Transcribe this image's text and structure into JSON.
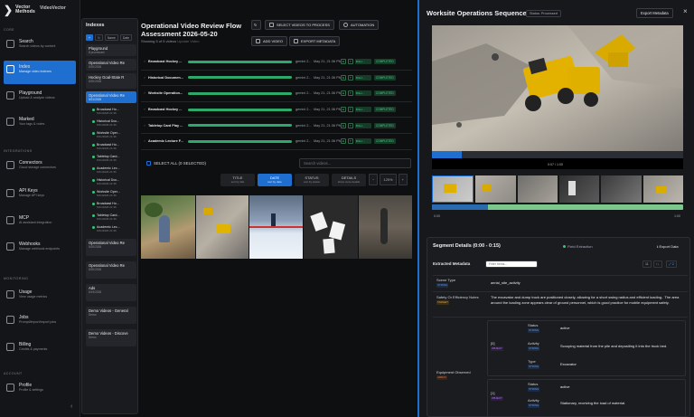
{
  "app": {
    "logo_text": "Vector Methods",
    "product": "VideoVector"
  },
  "nav": {
    "sections": {
      "core": "CORE",
      "integrations": "INTEGRATIONS",
      "monitoring": "MONITORING",
      "account": "ACCOUNT"
    },
    "items": [
      {
        "label": "Search",
        "sub": "Search videos by content"
      },
      {
        "label": "Index",
        "sub": "Manage video indexes"
      },
      {
        "label": "Playground",
        "sub": "Upload & analyze videos"
      },
      {
        "label": "Marked",
        "sub": "Your tags & notes"
      },
      {
        "label": "Connectors",
        "sub": "Cloud storage connectors"
      },
      {
        "label": "API Keys",
        "sub": "Manage API keys"
      },
      {
        "label": "MCP",
        "sub": "AI assistant integration"
      },
      {
        "label": "Webhooks",
        "sub": "Manage webhook endpoints"
      },
      {
        "label": "Usage",
        "sub": "View usage metrics"
      },
      {
        "label": "Jobs",
        "sub": "Prompt/import/export jobs"
      },
      {
        "label": "Billing",
        "sub": "Credits & payments"
      },
      {
        "label": "Profile",
        "sub": "Profile & settings"
      }
    ],
    "active": "Index",
    "collapse_icon": "chevron-left-icon"
  },
  "indexes": {
    "title": "Indexes",
    "tools": [
      "+",
      "↻",
      "Name",
      "Date"
    ],
    "items": [
      {
        "title": "Playground",
        "date": "8 processed"
      },
      {
        "title": "Operational Video Re",
        "date": "5/20/2026"
      },
      {
        "title": "Hockey Goal-State R",
        "date": "5/20/2026"
      },
      {
        "title": "Operational Video Re",
        "date": "5/21/2026"
      }
    ],
    "videos": [
      {
        "title": "Broadcast Ho...",
        "date": "5/21/2026 21:36"
      },
      {
        "title": "Historical Doc...",
        "date": "5/21/2026 21:36"
      },
      {
        "title": "Worksite Oper...",
        "date": "5/21/2026 21:36"
      },
      {
        "title": "Broadcast Ho...",
        "date": "5/21/2026 21:36"
      },
      {
        "title": "Tabletop Card...",
        "date": "5/21/2026 21:36"
      },
      {
        "title": "Academic Lec...",
        "date": "5/21/2026 21:36"
      },
      {
        "title": "Historical Doc...",
        "date": "5/21/2026 21:36"
      },
      {
        "title": "Worksite Oper...",
        "date": "5/21/2026 21:36"
      },
      {
        "title": "Broadcast Ho...",
        "date": "5/21/2026 21:36"
      },
      {
        "title": "Tabletop Card...",
        "date": "5/21/2026 21:36"
      },
      {
        "title": "Academic Lec...",
        "date": "5/21/2026 21:36"
      }
    ],
    "more": [
      {
        "title": "Operational Video Re",
        "date": "5/20/2026"
      },
      {
        "title": "Operational Video Re",
        "date": "5/20/2026"
      },
      {
        "title": "Ads",
        "date": "5/19/2026"
      },
      {
        "title": "Demo Videos - General",
        "date": "Demo"
      },
      {
        "title": "Demo Videos - Discove",
        "date": "Demo"
      }
    ]
  },
  "main": {
    "title": "Operational Video Review Flow Assessment 2026-05-20",
    "count": "Showing 5 of 5 videos",
    "count_link": "Update Video",
    "buttons": {
      "refresh": "↻",
      "select": "SELECT VIDEOS TO PROCESS",
      "automation": "AUTOMATION",
      "add": "ADD VIDEO",
      "export": "EXPORT METADATA"
    },
    "rows": [
      {
        "name": "Broadcast Hockey ...",
        "model": "gemini 2...",
        "date": "May 21, 21:36 PM",
        "b1": "E",
        "b2": "T",
        "b3": "BILLI...",
        "status": "COMPLETED"
      },
      {
        "name": "Historical Documen...",
        "model": "gemini 2...",
        "date": "May 21, 21:36 PM",
        "b1": "E",
        "b2": "T",
        "b3": "BILLI...",
        "status": "COMPLETED"
      },
      {
        "name": "Worksite Operation...",
        "model": "gemini 2...",
        "date": "May 21, 21:36 PM",
        "b1": "E",
        "b2": "T",
        "b3": "BILLI...",
        "status": "COMPLETED"
      },
      {
        "name": "Broadcast Hockey ...",
        "model": "gemini 2...",
        "date": "May 21, 21:36 PM",
        "b1": "E",
        "b2": "T",
        "b3": "BILLI...",
        "status": "COMPLETED"
      },
      {
        "name": "Tabletop Card Play ...",
        "model": "gemini 2...",
        "date": "May 21, 21:36 PM",
        "b1": "E",
        "b2": "T",
        "b3": "BILLI...",
        "status": "COMPLETED"
      },
      {
        "name": "Academic Lecture F...",
        "model": "gemini 2...",
        "date": "May 21, 21:36 PM",
        "b1": "E",
        "b2": "T",
        "b3": "BILLI...",
        "status": "COMPLETED"
      }
    ],
    "select_all": "SELECT ALL (0 SELECTED)",
    "search_placeholder": "Search videos...",
    "sorts": [
      {
        "label": "TITLE",
        "sub": "sort by title"
      },
      {
        "label": "DATE",
        "sub": "sort by date"
      },
      {
        "label": "STATUS",
        "sub": "sort by status"
      },
      {
        "label": "DETAILS",
        "sub": "show more details"
      }
    ],
    "zoom": {
      "minus": "−",
      "value": "125%",
      "plus": "+"
    }
  },
  "detail": {
    "title": "Worksite Operations Sequence",
    "status": "Status: Processed",
    "export": "Export Metadata",
    "close": "×",
    "video_time": "0:07 / 1:00",
    "progress": 0.12,
    "tl_start": "0:00",
    "tl_end": "1:00",
    "segment_title": "Segment Details (0:00 - 0:15)",
    "field_extraction": "Field Extraction",
    "export_data": "Export Data",
    "extracted": "Extracted Metadata",
    "filter_placeholder": "Filter fields...",
    "controls": [
      "11",
      "↑↓",
      "⤢ 2"
    ],
    "fields": [
      {
        "key": "Scene Type",
        "type": "STRING",
        "value": "aerial_site_activity"
      },
      {
        "key": "Safety Or Efficiency Notes",
        "type": "TARGET",
        "value": "The excavator and dump truck are positioned closely, allowing for a short swing radius and efficient loading.. The area around the loading zone appears clear of ground personnel, which is good practice for mobile equipment safety."
      },
      {
        "key": "Equipment Observed",
        "type": "ARRAY"
      }
    ],
    "equipment": [
      {
        "idx": "[0]",
        "type": "OBJECT",
        "status": "active",
        "activity": "Scooping material from the pile and depositing it into the truck bed.",
        "kind": "Excavator"
      },
      {
        "idx": "[1]",
        "type": "OBJECT",
        "status": "active",
        "activity": "Stationary, receiving the load of material."
      }
    ],
    "labels": {
      "status": "Status",
      "activity": "Activity",
      "type": "Type",
      "str": "STRING"
    }
  }
}
